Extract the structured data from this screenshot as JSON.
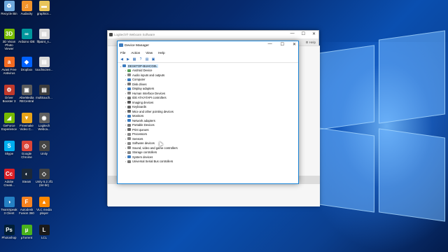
{
  "desktop_icons": [
    {
      "label": "Recycle Bin",
      "icon": "recycle-bin-icon",
      "color": "#6fa8dc",
      "glyph": "♻"
    },
    {
      "label": "Audacity",
      "icon": "audacity-icon",
      "color": "#f0922b",
      "glyph": "♫"
    },
    {
      "label": "graphics...",
      "icon": "folder-icon",
      "color": "#e8c45a",
      "glyph": "▬"
    },
    {
      "label": "3D Vision Photo Viewer",
      "icon": "3d-vision-icon",
      "color": "#76b900",
      "glyph": "3D"
    },
    {
      "label": "Arduino IDE",
      "icon": "arduino-icon",
      "color": "#00979c",
      "glyph": "∞"
    },
    {
      "label": "lllpaint_s...",
      "icon": "document-icon",
      "color": "#d9d9d9",
      "glyph": "▤"
    },
    {
      "label": "Avast Free Antivirus",
      "icon": "avast-icon",
      "color": "#f26b21",
      "glyph": "a"
    },
    {
      "label": "Dropbox",
      "icon": "dropbox-icon",
      "color": "#0061fe",
      "glyph": "◆"
    },
    {
      "label": "touchscree...",
      "icon": "touchscreen-icon",
      "color": "#d9d9d9",
      "glyph": "▤"
    },
    {
      "label": "Driver Booster 3",
      "icon": "driver-booster-icon",
      "color": "#c0392b",
      "glyph": "⚙"
    },
    {
      "label": "AlterMedia RECentral",
      "icon": "recentral-icon",
      "color": "#5b5b5b",
      "glyph": "▣"
    },
    {
      "label": "multitouch...",
      "icon": "multitouch-icon",
      "color": "#3c3c3c",
      "glyph": "▤"
    },
    {
      "label": "GeForce Experience",
      "icon": "geforce-icon",
      "color": "#76b900",
      "glyph": "◢"
    },
    {
      "label": "Freemake Video C...",
      "icon": "freemake-icon",
      "color": "#e8a317",
      "glyph": "▼"
    },
    {
      "label": "Logitech Webca...",
      "icon": "logitech-webcam-icon",
      "color": "#606060",
      "glyph": "◉"
    },
    {
      "label": "Skype",
      "icon": "skype-icon",
      "color": "#00aff0",
      "glyph": "S"
    },
    {
      "label": "Google Chrome",
      "icon": "chrome-icon",
      "color": "#db4437",
      "glyph": "◎"
    },
    {
      "label": "Unity",
      "icon": "unity-icon",
      "color": "#444",
      "glyph": "◇"
    },
    {
      "label": "Adobe Creati...",
      "icon": "adobe-cc-icon",
      "color": "#da1f26",
      "glyph": "Cc"
    },
    {
      "label": "Steam",
      "icon": "steam-icon",
      "color": "#1b2838",
      "glyph": "◐"
    },
    {
      "label": "Unity 5.2.3f1 (64-bit)",
      "icon": "unity-icon",
      "color": "#444",
      "glyph": "◇"
    },
    {
      "label": "TeamSpeak 3 Client",
      "icon": "teamspeak-icon",
      "color": "#2580c3",
      "glyph": "◑"
    },
    {
      "label": "Autodesk Fusion 360",
      "icon": "fusion-360-icon",
      "color": "#f58220",
      "glyph": "F"
    },
    {
      "label": "VLC media player",
      "icon": "vlc-icon",
      "color": "#ff8800",
      "glyph": "▲"
    },
    {
      "label": "Photoshop",
      "icon": "photoshop-icon",
      "color": "#001e36",
      "glyph": "Ps"
    },
    {
      "label": "µTorrent",
      "icon": "utorrent-icon",
      "color": "#4ab31c",
      "glyph": "µ"
    },
    {
      "label": "LCL",
      "icon": "lcl-icon",
      "color": "#1a1a1a",
      "glyph": "L"
    }
  ],
  "logitech_window": {
    "title": "Logitech® Webcam Software",
    "help": "Help",
    "minimize": "—",
    "maximize": "☐",
    "close": "✕"
  },
  "device_manager": {
    "title": "Device Manager",
    "minimize": "—",
    "maximize": "☐",
    "close": "✕",
    "menu": [
      "File",
      "Action",
      "View",
      "Help"
    ],
    "toolbar": [
      "back-icon",
      "forward-icon",
      "properties-icon",
      "help-icon",
      "update-driver-icon",
      "monitor-icon"
    ],
    "root": "DESKTOP-BUHCGEL",
    "nodes": [
      {
        "label": "Android Device",
        "color": "#5aa05a"
      },
      {
        "label": "Audio inputs and outputs",
        "color": "#888"
      },
      {
        "label": "Computer",
        "color": "#3b7bbf"
      },
      {
        "label": "Disk drives",
        "color": "#777"
      },
      {
        "label": "Display adapters",
        "color": "#3b7bbf"
      },
      {
        "label": "Human Interface Devices",
        "color": "#888"
      },
      {
        "label": "IDE ATA/ATAPI controllers",
        "color": "#777"
      },
      {
        "label": "Imaging devices",
        "color": "#555"
      },
      {
        "label": "Keyboards",
        "color": "#666"
      },
      {
        "label": "Mice and other pointing devices",
        "color": "#666"
      },
      {
        "label": "Monitors",
        "color": "#3b7bbf"
      },
      {
        "label": "Network adapters",
        "color": "#3b7bbf"
      },
      {
        "label": "Portable Devices",
        "color": "#777"
      },
      {
        "label": "Print queues",
        "color": "#666"
      },
      {
        "label": "Processors",
        "color": "#888"
      },
      {
        "label": "Sensors",
        "color": "#888"
      },
      {
        "label": "Software devices",
        "color": "#888"
      },
      {
        "label": "Sound, video and game controllers",
        "color": "#888"
      },
      {
        "label": "Storage controllers",
        "color": "#888"
      },
      {
        "label": "System devices",
        "color": "#3b7bbf"
      },
      {
        "label": "Universal Serial Bus controllers",
        "color": "#777"
      }
    ]
  }
}
